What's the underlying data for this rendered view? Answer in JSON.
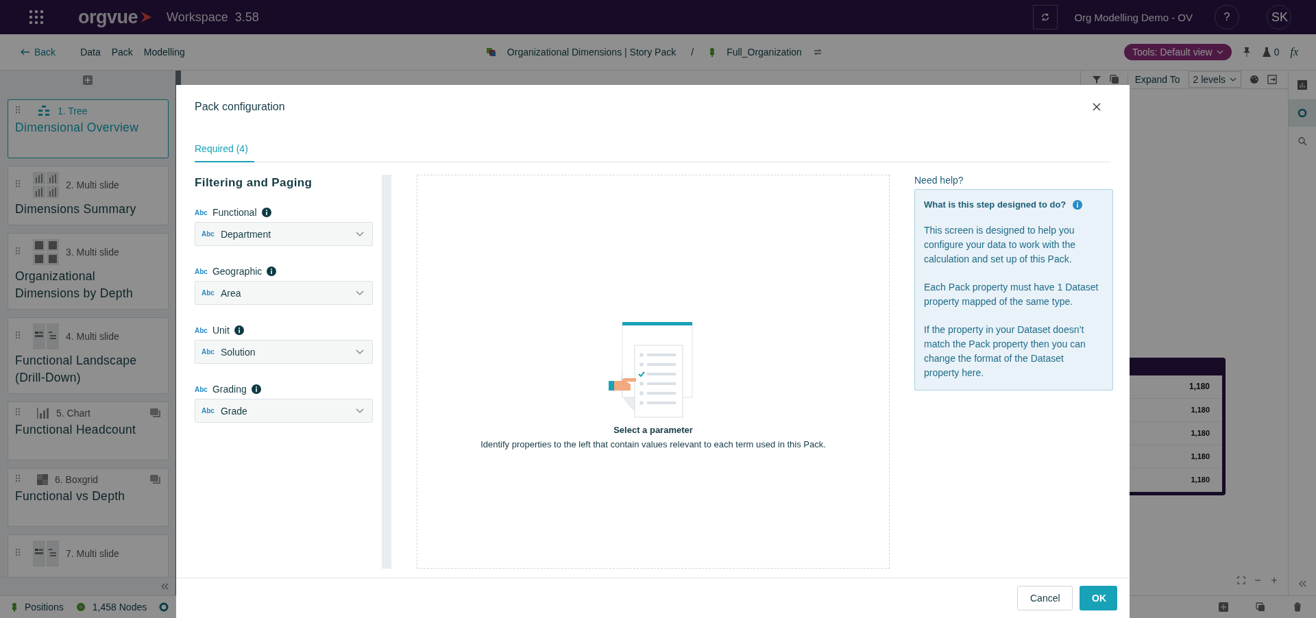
{
  "app": {
    "name": "orgvue",
    "workspace": "Workspace",
    "version": "3.58",
    "user": "Org Modelling Demo - OV",
    "help": "?",
    "avatar": "SK"
  },
  "nav": {
    "back": "Back",
    "menu": [
      "Data",
      "Pack",
      "Modelling"
    ],
    "pack": "Organizational Dimensions | Story Pack",
    "separator": "/",
    "dataset": "Full_Organization",
    "tools": "Tools: Default view",
    "beaker_count": "0",
    "fx": "fx"
  },
  "slides": [
    {
      "number": "1. Tree",
      "title": "Dimensional Overview",
      "selected": true,
      "kind": "tree",
      "comments": false
    },
    {
      "number": "2. Multi slide",
      "title": "Dimensions Summary",
      "selected": false,
      "kind": "bars",
      "comments": false
    },
    {
      "number": "3. Multi slide",
      "title": "Organizational Dimensions by Depth",
      "selected": false,
      "kind": "grids",
      "comments": false
    },
    {
      "number": "4. Multi slide",
      "title": "Functional Landscape (Drill-Down)",
      "selected": false,
      "kind": "layout",
      "comments": false
    },
    {
      "number": "5. Chart",
      "title": "Functional Headcount",
      "selected": false,
      "kind": "chart",
      "comments": true
    },
    {
      "number": "6. Boxgrid",
      "title": "Functional vs Depth",
      "selected": false,
      "kind": "boxgrid",
      "comments": true
    },
    {
      "number": "7. Multi slide",
      "selected": false,
      "kind": "layout",
      "comments": false
    }
  ],
  "page": {
    "expand_label": "Expand To",
    "expand_value": "2 levels"
  },
  "table_values": [
    "1,180",
    "1,180",
    "1,180",
    "1,180",
    "1,180"
  ],
  "status": {
    "positions": "Positions",
    "nodes": "1,458 Nodes"
  },
  "modal": {
    "title": "Pack configuration",
    "tabs": [
      {
        "label": "Required (4)",
        "selected": true
      }
    ],
    "section": "Filtering and Paging",
    "fields": [
      {
        "type": "Abc",
        "label": "Functional",
        "value_type": "Abc",
        "value": "Department"
      },
      {
        "type": "Abc",
        "label": "Geographic",
        "value_type": "Abc",
        "value": "Area"
      },
      {
        "type": "Abc",
        "label": "Unit",
        "value_type": "Abc",
        "value": "Solution"
      },
      {
        "type": "Abc",
        "label": "Grading",
        "value_type": "Abc",
        "value": "Grade"
      }
    ],
    "empty": {
      "title": "Select a parameter",
      "text": "Identify properties to the left that contain values relevant to each term used in this Pack."
    },
    "help": {
      "label": "Need help?",
      "title": "What is this step designed to do?",
      "paragraphs": [
        "This screen is designed to help you configure your data to work with the calculation and set up of this Pack.",
        "Each Pack property must have 1 Dataset property mapped of the same type.",
        "If the property in your Dataset doesn’t match the Pack property then you can change the format of the Dataset property here."
      ]
    },
    "buttons": [
      {
        "label": "Cancel",
        "kind": "secondary"
      },
      {
        "label": "OK",
        "kind": "primary"
      }
    ]
  }
}
